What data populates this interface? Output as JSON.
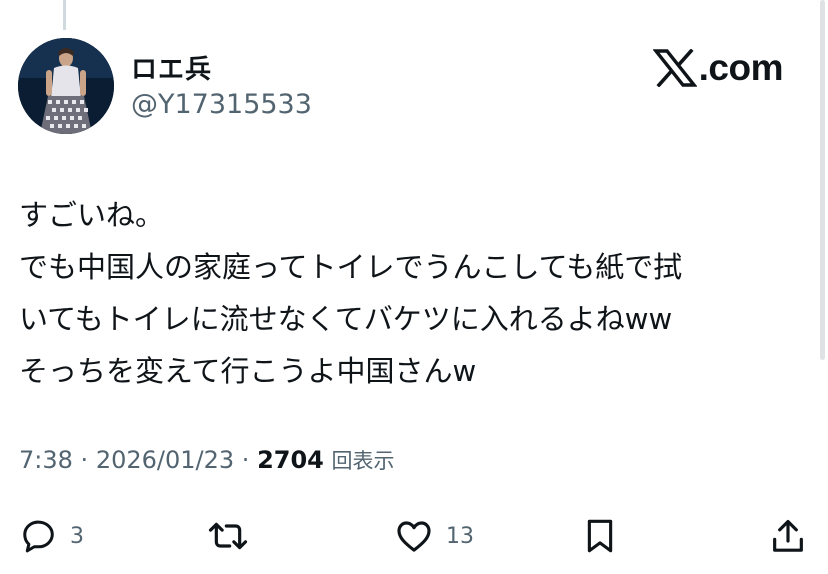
{
  "author": {
    "display_name": "ロエ兵",
    "handle": "@Y17315533"
  },
  "brand": {
    "text": ".com"
  },
  "tweet": {
    "lines": [
      "すごいね。",
      "でも中国人の家庭ってトイレでうんこしても紙で拭",
      "いてもトイレに流せなくてバケツに入れるよねww",
      "そっちを変えて行こうよ中国さんw"
    ]
  },
  "meta": {
    "time": "7:38",
    "separator": "·",
    "date": "2026/01/23",
    "views": "2704",
    "views_unit": "回表示"
  },
  "actions": {
    "reply_count": "3",
    "like_count": "13"
  },
  "icons": {
    "reply": "speech-bubble-icon",
    "repost": "repost-arrows-icon",
    "like": "heart-icon",
    "bookmark": "bookmark-icon",
    "share": "share-upload-icon",
    "brand": "x-logo-icon"
  },
  "colors": {
    "text": "#0f1419",
    "secondary": "#536471"
  }
}
